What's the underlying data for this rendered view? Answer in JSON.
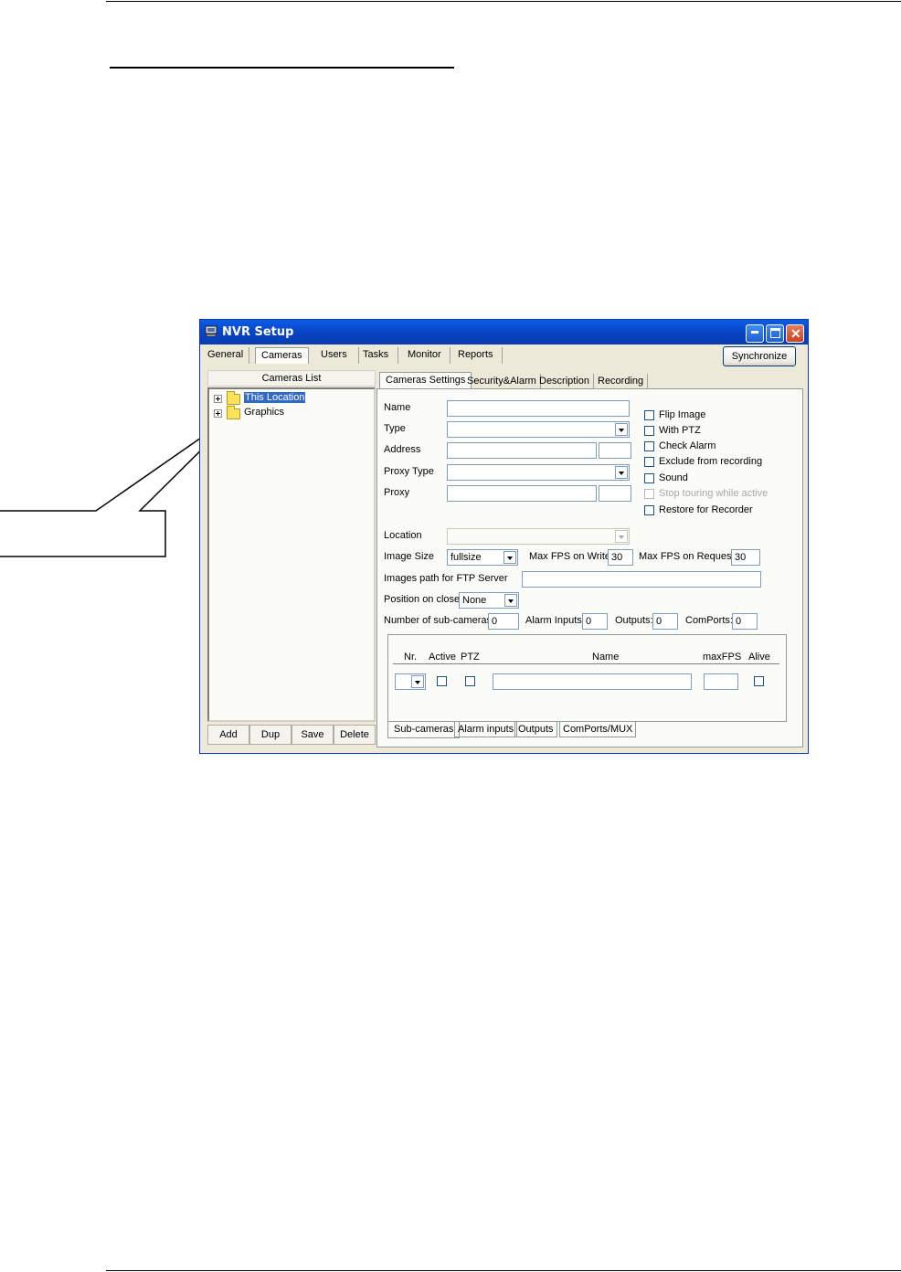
{
  "window": {
    "title": "NVR Setup",
    "icon": "monitor-icon",
    "controls": [
      "minimize-icon",
      "maximize-icon",
      "close-icon"
    ]
  },
  "main_tabs": [
    {
      "label": "General",
      "selected": false
    },
    {
      "label": "Cameras",
      "selected": true
    },
    {
      "label": "Users",
      "selected": false
    },
    {
      "label": "Tasks",
      "selected": false
    },
    {
      "label": "Monitor",
      "selected": false
    },
    {
      "label": "Reports",
      "selected": false
    }
  ],
  "synchronize_label": "Synchronize",
  "cameras_list": {
    "header": "Cameras List",
    "items": [
      {
        "label": "This Location",
        "selected": true
      },
      {
        "label": "Graphics",
        "selected": false
      }
    ],
    "buttons": [
      "Add",
      "Dup",
      "Save",
      "Delete"
    ]
  },
  "settings_tabs": [
    "Cameras Settings",
    "Security&Alarm",
    "Description",
    "Recording"
  ],
  "form": {
    "name_label": "Name",
    "type_label": "Type",
    "address_label": "Address",
    "proxy_type_label": "Proxy Type",
    "proxy_label": "Proxy",
    "location_label": "Location",
    "image_size_label": "Image Size",
    "image_size_value": "fullsize",
    "max_fps_write_label": "Max FPS on Write",
    "max_fps_write_value": "30",
    "max_fps_request_label": "Max FPS on Request",
    "max_fps_request_value": "30",
    "ftp_path_label": "Images path for FTP Server",
    "position_on_close_label": "Position on close",
    "position_on_close_value": "None",
    "sub_cameras_label": "Number of sub-cameras:",
    "sub_cameras_value": "0",
    "alarm_inputs_label": "Alarm Inputs:",
    "alarm_inputs_value": "0",
    "outputs_label": "Outputs:",
    "outputs_value": "0",
    "comports_label": "ComPorts:",
    "comports_value": "0"
  },
  "options": [
    {
      "label": "Flip Image",
      "checked": false,
      "enabled": true
    },
    {
      "label": "With PTZ",
      "checked": false,
      "enabled": true
    },
    {
      "label": "Check Alarm",
      "checked": false,
      "enabled": true
    },
    {
      "label": "Exclude from recording",
      "checked": false,
      "enabled": true
    },
    {
      "label": "Sound",
      "checked": false,
      "enabled": true
    },
    {
      "label": "Stop touring while active",
      "checked": false,
      "enabled": false
    },
    {
      "label": "Restore for Recorder",
      "checked": false,
      "enabled": true
    }
  ],
  "subcam_table": {
    "headers": [
      "Nr.",
      "Active",
      "PTZ",
      "Name",
      "maxFPS",
      "Alive"
    ]
  },
  "bottom_tabs": [
    "Sub-cameras",
    "Alarm inputs",
    "Outputs",
    "ComPorts/MUX"
  ]
}
